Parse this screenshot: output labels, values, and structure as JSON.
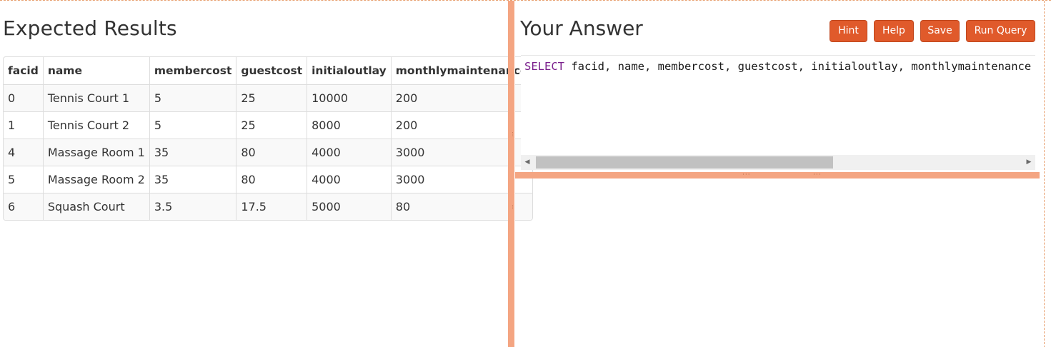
{
  "left": {
    "title": "Expected Results",
    "table": {
      "columns": [
        "facid",
        "name",
        "membercost",
        "guestcost",
        "initialoutlay",
        "monthlymaintenance"
      ],
      "rows": [
        [
          "0",
          "Tennis Court 1",
          "5",
          "25",
          "10000",
          "200"
        ],
        [
          "1",
          "Tennis Court 2",
          "5",
          "25",
          "8000",
          "200"
        ],
        [
          "4",
          "Massage Room 1",
          "35",
          "80",
          "4000",
          "3000"
        ],
        [
          "5",
          "Massage Room 2",
          "35",
          "80",
          "4000",
          "3000"
        ],
        [
          "6",
          "Squash Court",
          "3.5",
          "17.5",
          "5000",
          "80"
        ]
      ]
    }
  },
  "right": {
    "title": "Your Answer",
    "buttons": {
      "hint": "Hint",
      "help": "Help",
      "save": "Save",
      "run": "Run Query"
    },
    "editor": {
      "keyword": "SELECT",
      "rest": " facid, name, membercost, guestcost, initialoutlay, monthlymaintenance"
    }
  },
  "colors": {
    "accent_button": "#e05a2b",
    "splitter": "#f4a582",
    "sql_keyword": "#7a1f8c",
    "row_stripe": "#f9f9f9"
  },
  "icons": {
    "scroll_left": "triangle-left-icon",
    "scroll_right": "triangle-right-icon"
  }
}
